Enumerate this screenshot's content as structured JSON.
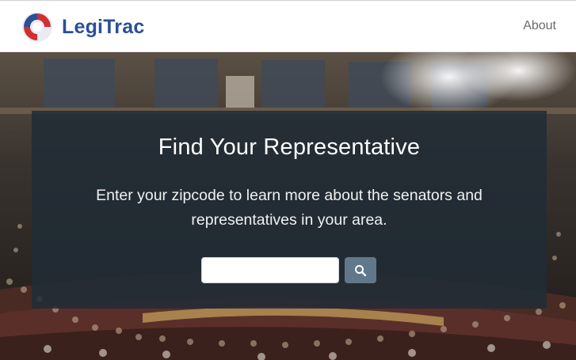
{
  "header": {
    "brand_part1": "Legi",
    "brand_part2": "Trac",
    "nav": {
      "about_label": "About"
    }
  },
  "colors": {
    "brand_blue": "#2a4f96",
    "brand_red": "#d32f2f",
    "card_bg": "#212c36",
    "search_button": "#60788a"
  },
  "hero": {
    "title": "Find Your Representative",
    "subtitle": "Enter your zipcode to learn more about the senators and representatives in your area.",
    "search": {
      "placeholder": "",
      "value": "",
      "button_icon": "search-icon"
    }
  }
}
